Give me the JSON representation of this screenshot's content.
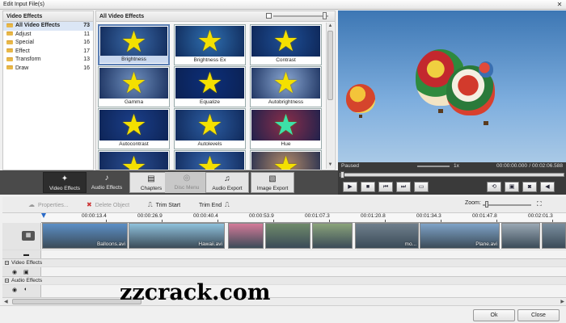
{
  "window": {
    "title": "Edit Input File(s)",
    "close_glyph": "✕"
  },
  "categories": {
    "header": "Video Effects",
    "items": [
      {
        "label": "All Video Effects",
        "count": "73"
      },
      {
        "label": "Adjust",
        "count": "11"
      },
      {
        "label": "Special",
        "count": "16"
      },
      {
        "label": "Effect",
        "count": "17"
      },
      {
        "label": "Transform",
        "count": "13"
      },
      {
        "label": "Draw",
        "count": "16"
      }
    ]
  },
  "effects": {
    "header": "All Video Effects",
    "tiles": [
      {
        "label": "Brightness",
        "bg": "#3a6aa8"
      },
      {
        "label": "Brightness Ex",
        "bg": "#2f6fb0"
      },
      {
        "label": "Contrast",
        "bg": "#1e4f96"
      },
      {
        "label": "Gamma",
        "bg": "#6e8fbf"
      },
      {
        "label": "Equalize",
        "bg": "#0d2f7a"
      },
      {
        "label": "Autobrightness",
        "bg": "#8aa8d4"
      },
      {
        "label": "Autocontrast",
        "bg": "#1b3f8a"
      },
      {
        "label": "Autolevels",
        "bg": "#2c5ea3"
      },
      {
        "label": "Hue",
        "bg": "#8a2e4a"
      },
      {
        "label": "",
        "bg": "#2a4e92"
      },
      {
        "label": "",
        "bg": "#3566ad"
      },
      {
        "label": "",
        "bg": "#b48a68"
      }
    ]
  },
  "player": {
    "status": "Paused",
    "speed": "1x",
    "position": "00:00:00.000",
    "duration": "/ 00:02:06.588"
  },
  "toolbar": {
    "video_effects": "Video Effects",
    "audio_effects": "Audio Effects",
    "chapters": "Chapters",
    "disc_menu": "Disc Menu",
    "audio_export": "Audio Export",
    "image_export": "Image Export"
  },
  "timeline_toolbar": {
    "properties": "Properties...",
    "delete_object": "Delete Object",
    "trim_start": "Trim Start",
    "trim_end": "Trim End",
    "zoom": "Zoom:"
  },
  "ruler": [
    "00:00:13.4",
    "00:00:26.9",
    "00:00:40.4",
    "00:00:53.9",
    "00:01:07.3",
    "00:01:20.8",
    "00:01:34.3",
    "00:01:47.8",
    "00:02:01.3"
  ],
  "clips": [
    {
      "name": "Balloons.avi",
      "bg": "#5c8fc6"
    },
    {
      "name": "Hawaii.avi",
      "bg": "#8fc2dc"
    },
    {
      "name": "",
      "bg": "#d47a98"
    },
    {
      "name": "",
      "bg": "#6f8a6a"
    },
    {
      "name": "",
      "bg": "#8aa37a"
    },
    {
      "name": "mo...",
      "bg": "#6f7f8c"
    },
    {
      "name": "Plane.avi",
      "bg": "#7fa3c8"
    },
    {
      "name": "",
      "bg": "#9aa8b4"
    },
    {
      "name": "",
      "bg": "#7a8e9e"
    }
  ],
  "sections": {
    "video_effects": "Video Effects",
    "audio_effects": "Audio Effects"
  },
  "watermark": "zzcrack.com",
  "footer": {
    "ok": "Ok",
    "close": "Close"
  }
}
